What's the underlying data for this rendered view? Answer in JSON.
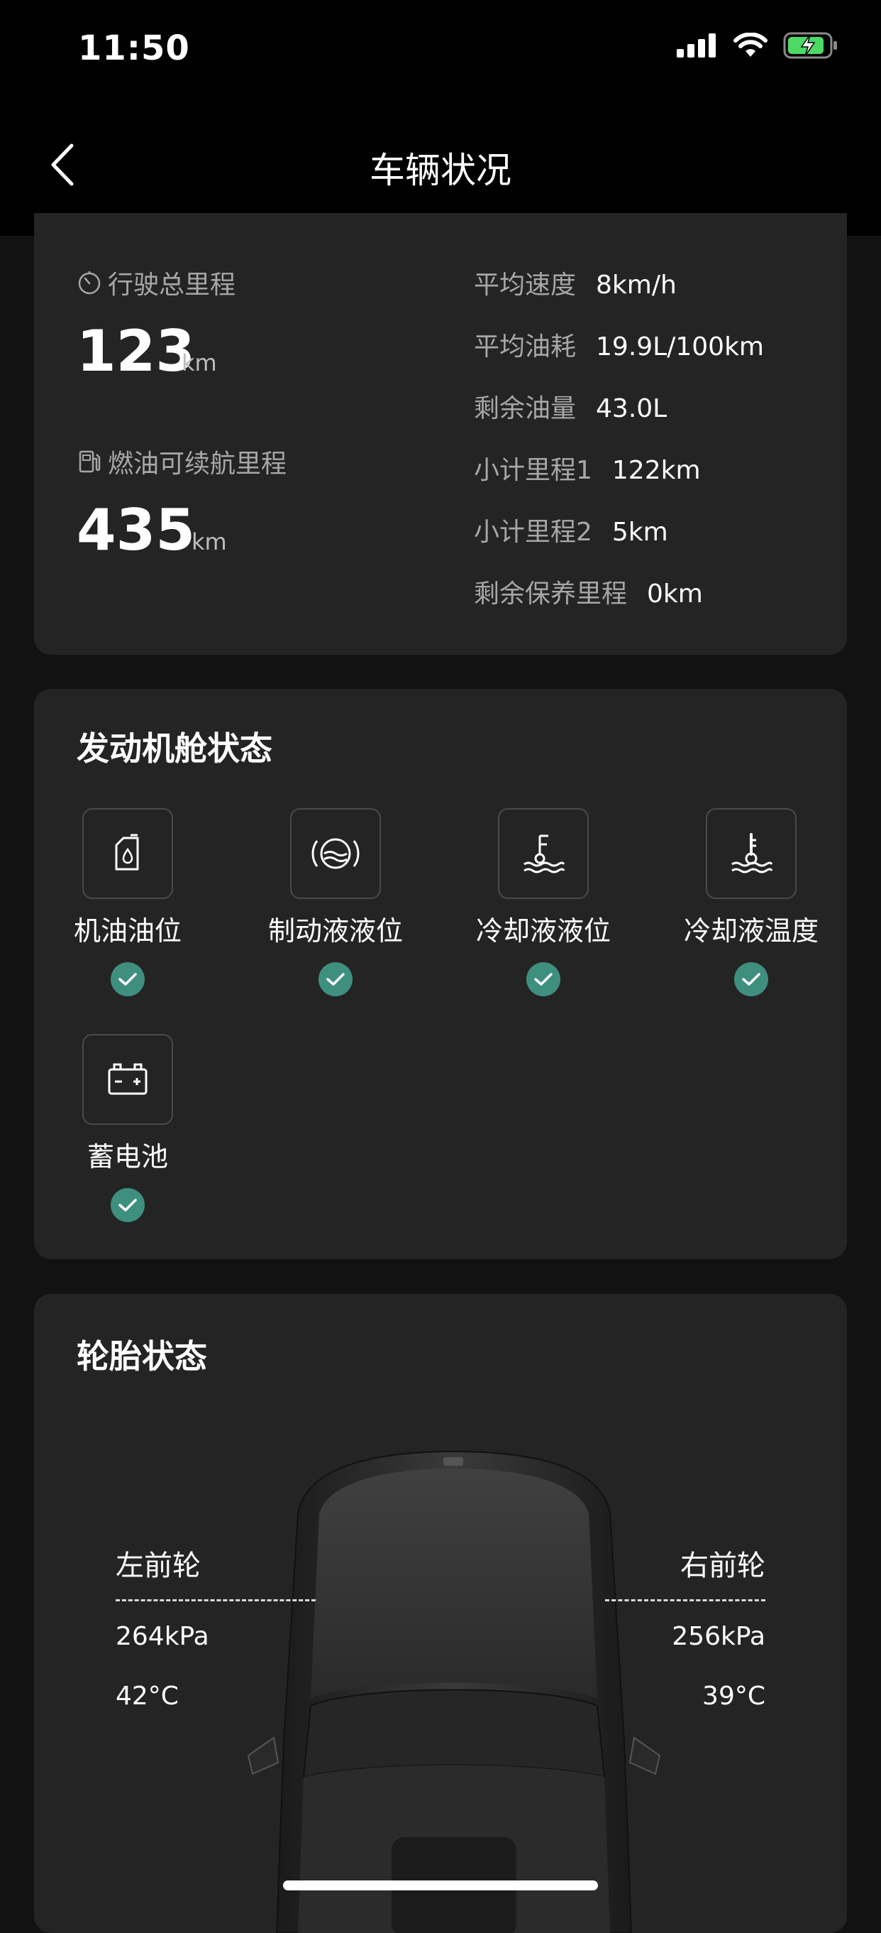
{
  "status_bar": {
    "time": "11:50"
  },
  "nav": {
    "title": "车辆状况"
  },
  "mileage": {
    "total_label": "行驶总里程",
    "total_value": "123",
    "total_unit": "km",
    "range_label": "燃油可续航里程",
    "range_value": "435",
    "range_unit": "km",
    "stats": [
      {
        "label": "平均速度",
        "value": "8km/h"
      },
      {
        "label": "平均油耗",
        "value": "19.9L/100km"
      },
      {
        "label": "剩余油量",
        "value": "43.0L"
      },
      {
        "label": "小计里程1",
        "value": "122km"
      },
      {
        "label": "小计里程2",
        "value": "5km"
      },
      {
        "label": "剩余保养里程",
        "value": "0km"
      }
    ]
  },
  "engine": {
    "title": "发动机舱状态",
    "items": [
      {
        "label": "机油油位",
        "icon": "oil-can-icon",
        "status": "ok"
      },
      {
        "label": "制动液液位",
        "icon": "brake-fluid-icon",
        "status": "ok"
      },
      {
        "label": "冷却液液位",
        "icon": "coolant-level-icon",
        "status": "ok"
      },
      {
        "label": "冷却液温度",
        "icon": "coolant-temperature-icon",
        "status": "ok"
      },
      {
        "label": "蓄电池",
        "icon": "battery-icon",
        "status": "ok"
      }
    ]
  },
  "tires": {
    "title": "轮胎状态",
    "front_left": {
      "name": "左前轮",
      "pressure": "264kPa",
      "temp": "42°C"
    },
    "front_right": {
      "name": "右前轮",
      "pressure": "256kPa",
      "temp": "39°C"
    }
  },
  "colors": {
    "background": "#121212",
    "card": "#242424",
    "check": "#3f8f7f",
    "battery": "#4cd964"
  }
}
